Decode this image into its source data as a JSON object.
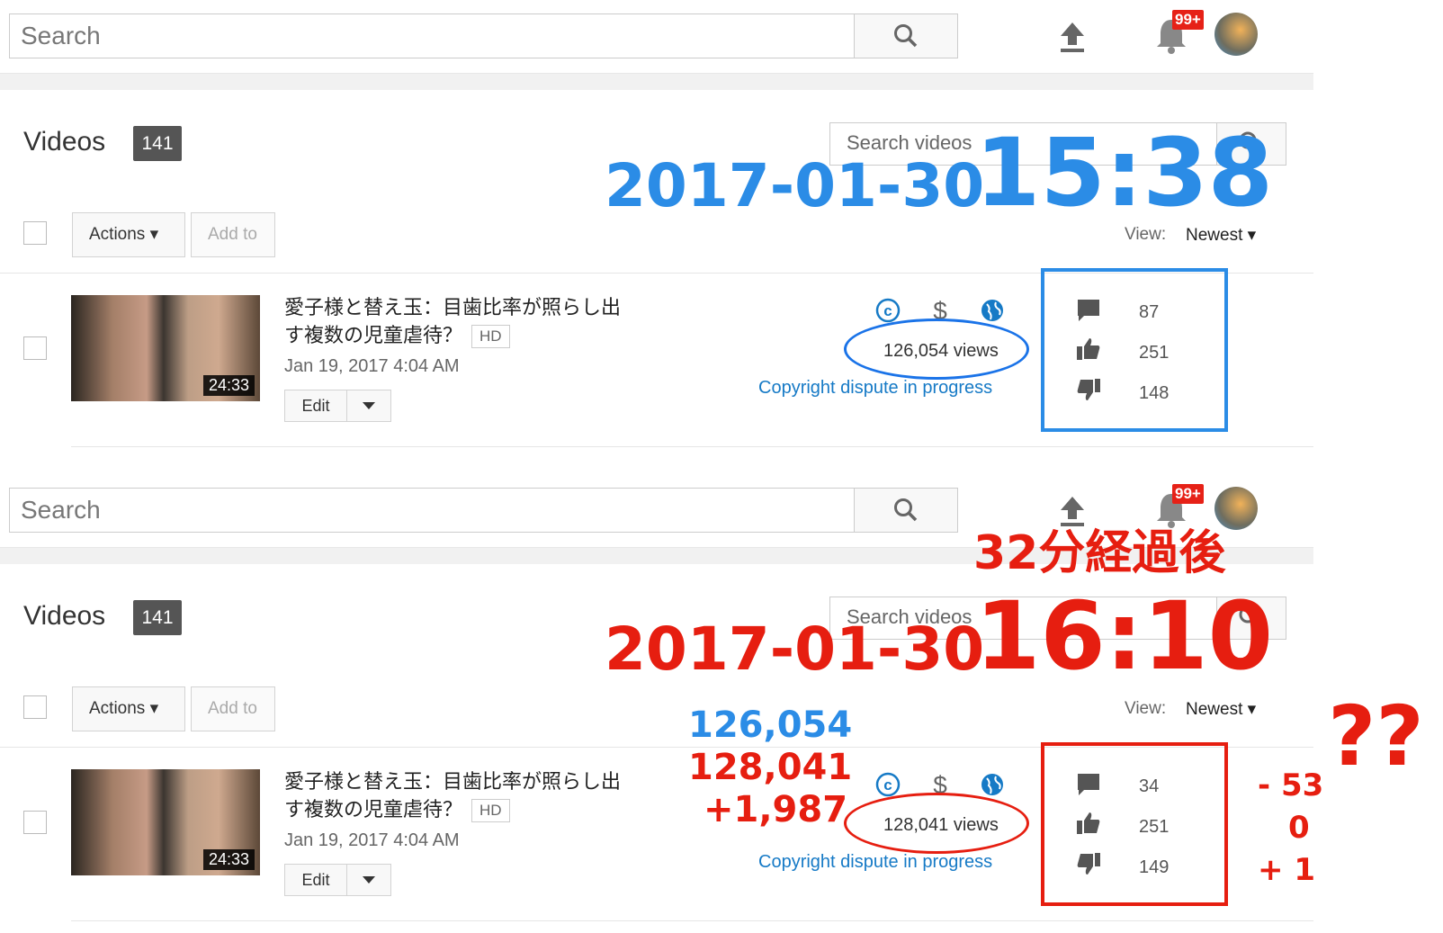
{
  "colors": {
    "accent_blue": "#2b8ce6",
    "accent_red": "#e61e10",
    "link": "#167ac6"
  },
  "panels": [
    {
      "search_placeholder": "Search",
      "notif_badge": "99+",
      "section_title": "Videos",
      "video_count": "141",
      "search_videos_placeholder": "Search videos",
      "actions_label": "Actions",
      "add_to_label": "Add to",
      "view_label": "View:",
      "sort_value": "Newest",
      "video": {
        "title": "愛子様と替え玉：目歯比率が照らし出す複数の児童虐待？",
        "hd": "HD",
        "date": "Jan 19, 2017 4:04 AM",
        "duration": "24:33",
        "edit_label": "Edit",
        "views": "126,054 views",
        "dispute": "Copyright dispute in progress",
        "comments": "87",
        "likes": "251",
        "dislikes": "148"
      },
      "annotation": {
        "date": "2017-01-30",
        "time": "15:38"
      }
    },
    {
      "search_placeholder": "Search",
      "notif_badge": "99+",
      "section_title": "Videos",
      "video_count": "141",
      "search_videos_placeholder": "Search videos",
      "actions_label": "Actions",
      "add_to_label": "Add to",
      "view_label": "View:",
      "sort_value": "Newest",
      "video": {
        "title": "愛子様と替え玉：目歯比率が照らし出す複数の児童虐待？",
        "hd": "HD",
        "date": "Jan 19, 2017 4:04 AM",
        "duration": "24:33",
        "edit_label": "Edit",
        "views": "128,041 views",
        "dispute": "Copyright dispute in progress",
        "comments": "34",
        "likes": "251",
        "dislikes": "149"
      },
      "annotation": {
        "elapsed": "32分経過後",
        "date": "2017-01-30",
        "time": "16:10",
        "views_before": "126,054",
        "views_after": "128,041",
        "views_diff": "+1,987",
        "comments_diff": "- 53",
        "likes_diff": "0",
        "dislikes_diff": "+ 1",
        "question": "??"
      }
    }
  ]
}
